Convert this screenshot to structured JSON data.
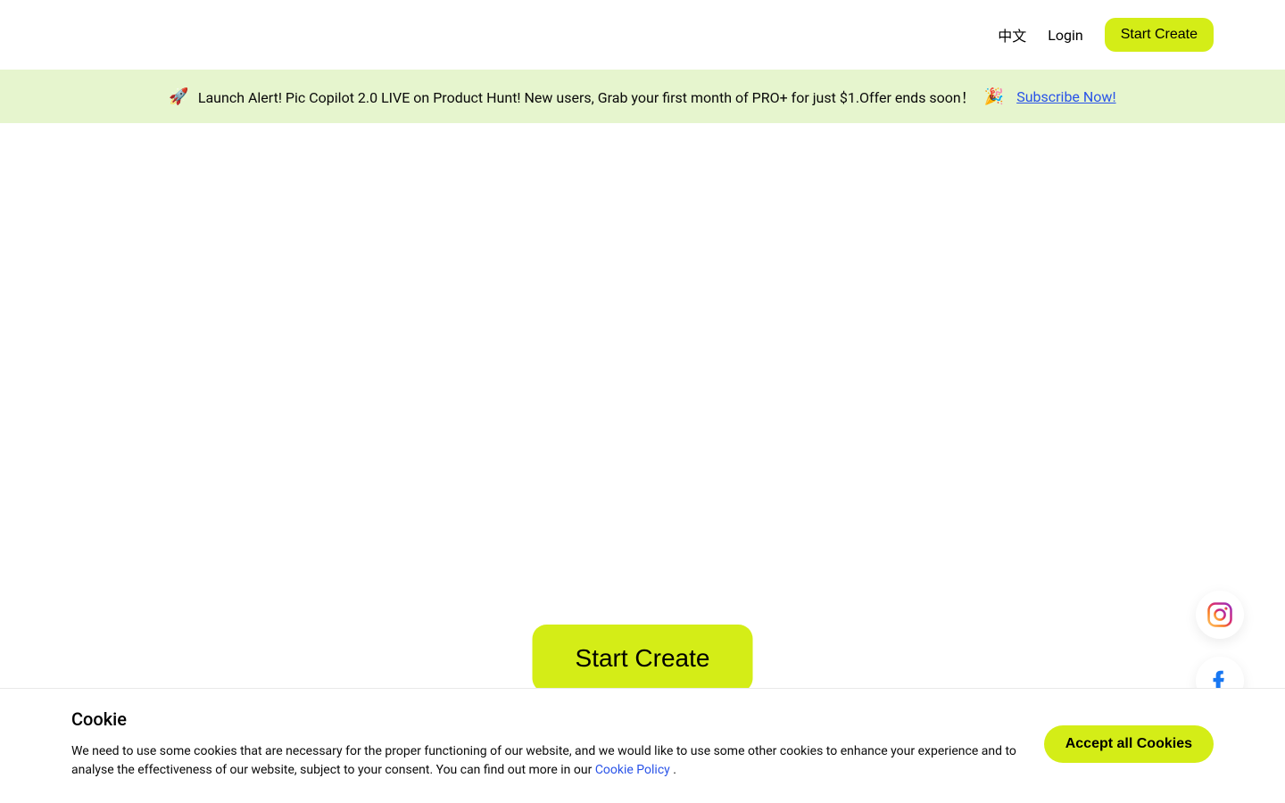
{
  "header": {
    "lang_label": "中文",
    "login_label": "Login",
    "cta_label": "Start Create"
  },
  "banner": {
    "emoji_rocket": "🚀",
    "text": "Launch Alert! Pic Copilot 2.0 LIVE on Product Hunt! New users, Grab your first month of PRO+ for just $1.Offer ends soon！",
    "emoji_party": "🎉",
    "link_label": "Subscribe Now!"
  },
  "main": {
    "cta_label": "Start Create"
  },
  "social": {
    "instagram_name": "instagram-icon",
    "facebook_name": "facebook-icon"
  },
  "cookie": {
    "title": "Cookie",
    "text": "We need to use some cookies that are necessary for the proper functioning of our website, and we would like to use some other cookies to enhance your experience and to analyse the effectiveness of our website, subject to your consent. You can find out more in our ",
    "policy_label": "Cookie Policy",
    "period": " .",
    "accept_label": "Accept all Cookies"
  }
}
